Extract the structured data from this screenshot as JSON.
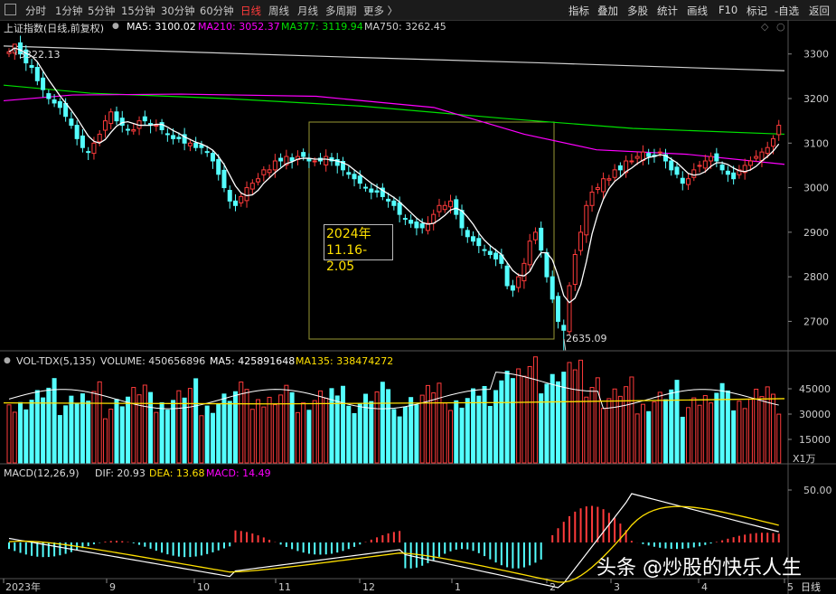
{
  "toolbar": {
    "periods": [
      "分时",
      "1分钟",
      "5分钟",
      "15分钟",
      "30分钟",
      "60分钟",
      "日线",
      "周线",
      "月线",
      "多周期",
      "更多 〉"
    ],
    "active_period": "日线",
    "right_buttons": [
      "指标",
      "叠加",
      "多股",
      "统计",
      "画线",
      "F10",
      "标记",
      "-自选",
      "返回"
    ]
  },
  "main_panel": {
    "title": "上证指数(日线,前复权)",
    "ma5": "MA5: 3100.02",
    "ma210": "MA210: 3052.37",
    "ma377": "MA377: 3119.94",
    "ma750": "MA750: 3262.45",
    "high_label": "3322.13",
    "low_label": "2635.09",
    "annotation_line1": "2024年",
    "annotation_line2": "11.16-2.05",
    "y_ticks": [
      "3300",
      "3200",
      "3100",
      "3000",
      "2900",
      "2800",
      "2700"
    ]
  },
  "volume_panel": {
    "title": "VOL-TDX(5,135)",
    "volume": "VOLUME: 450656896",
    "ma5": "MA5: 425891648",
    "ma135": "MA135: 338474272",
    "y_ticks": [
      "45000",
      "30000",
      "15000"
    ],
    "unit": "X1万"
  },
  "macd_panel": {
    "title": "MACD(12,26,9)",
    "dif": "DIF: 20.93",
    "dea": "DEA: 13.68",
    "macd": "MACD: 14.49",
    "y_tick": "50.00"
  },
  "x_axis": [
    "2023年",
    "9",
    "10",
    "11",
    "12",
    "1",
    "2",
    "3",
    "4",
    "5"
  ],
  "period_tag": "日线",
  "watermark": "头条 @炒股的快乐人生",
  "colors": {
    "up": "#ff3b3b",
    "down": "#54ffff",
    "ma5": "#ffffff",
    "ma210": "#ff00ff",
    "ma377": "#00e000",
    "ma750": "#d0d0d0",
    "dea": "#ffe000",
    "box": "#999933"
  },
  "chart_data": {
    "type": "candlestick",
    "approx_daily_closes": [
      3305,
      3322,
      3300,
      3280,
      3270,
      3240,
      3220,
      3200,
      3190,
      3180,
      3160,
      3140,
      3110,
      3090,
      3080,
      3100,
      3120,
      3150,
      3170,
      3150,
      3140,
      3130,
      3130,
      3150,
      3150,
      3140,
      3140,
      3130,
      3120,
      3110,
      3110,
      3100,
      3100,
      3090,
      3090,
      3080,
      3060,
      3030,
      3000,
      2970,
      2960,
      2980,
      3000,
      3010,
      3020,
      3040,
      3040,
      3060,
      3060,
      3070,
      3060,
      3070,
      3070,
      3060,
      3060,
      3060,
      3070,
      3060,
      3050,
      3040,
      3030,
      3020,
      3010,
      3000,
      2990,
      2990,
      2980,
      2970,
      2960,
      2940,
      2930,
      2920,
      2910,
      2910,
      2920,
      2940,
      2960,
      2960,
      2970,
      2940,
      2910,
      2890,
      2880,
      2870,
      2860,
      2850,
      2840,
      2830,
      2780,
      2770,
      2800,
      2830,
      2880,
      2900,
      2860,
      2800,
      2750,
      2700,
      2680,
      2780,
      2850,
      2900,
      2960,
      2990,
      3000,
      3020,
      3020,
      3040,
      3040,
      3060,
      3060,
      3070,
      3080,
      3070,
      3070,
      3080,
      3060,
      3040,
      3030,
      3010,
      3020,
      3040,
      3050,
      3060,
      3070,
      3060,
      3040,
      3030,
      3020,
      3040,
      3050,
      3060,
      3070,
      3080,
      3090,
      3110,
      3140
    ],
    "high": 3322.13,
    "low": 2635.09,
    "ylim": [
      2640,
      3340
    ],
    "ma210_end": 3052.37,
    "ma377_end": 3119.94,
    "ma750_end": 3262.45
  }
}
